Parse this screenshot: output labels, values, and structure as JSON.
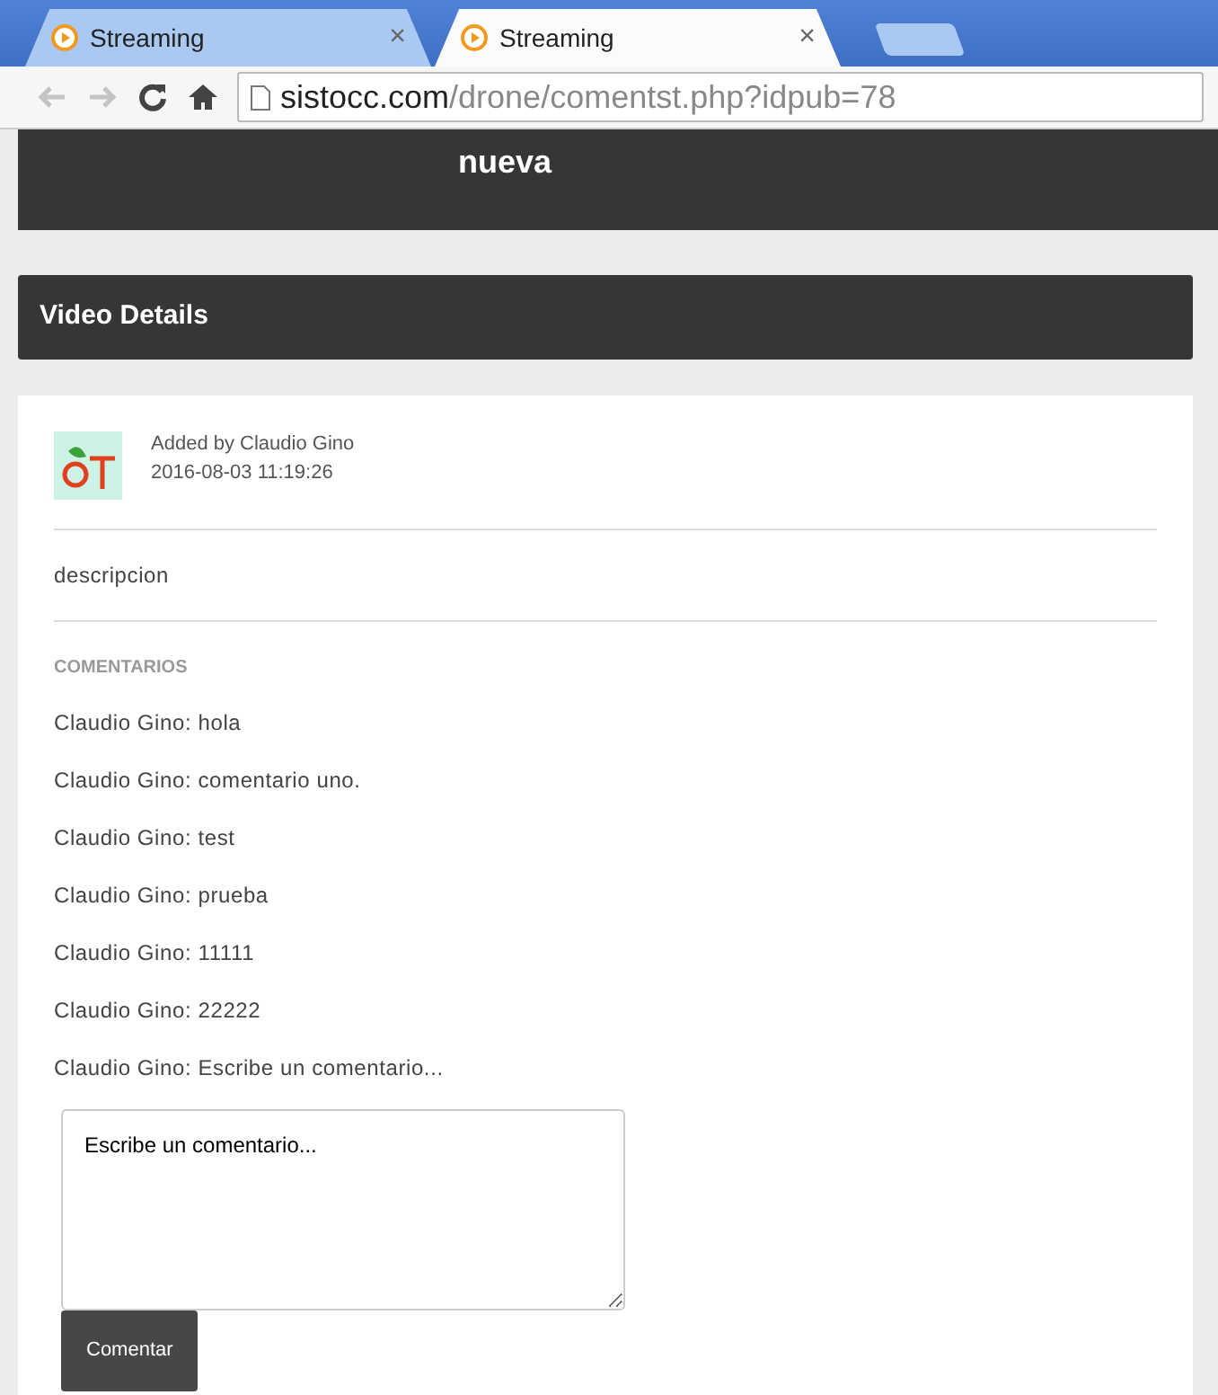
{
  "browser": {
    "tabs": [
      {
        "label": "Streaming",
        "close": "×",
        "selected": false
      },
      {
        "label": "Streaming",
        "close": "×",
        "selected": true
      }
    ],
    "address": {
      "domain": "sistocc.com",
      "path": "/drone/comentst.php?idpub=78"
    }
  },
  "header": {
    "title": "nueva"
  },
  "section": {
    "title": "Video Details"
  },
  "post": {
    "author": "Added by Claudio Gino",
    "date": "2016-08-03 11:19:26",
    "description": "descripcion"
  },
  "comments": {
    "heading": "COMENTARIOS",
    "items": [
      "Claudio Gino: hola",
      "Claudio Gino: comentario uno.",
      "Claudio Gino: test",
      "Claudio Gino: prueba",
      "Claudio Gino: 11111",
      "Claudio Gino: 22222",
      "Claudio Gino: Escribe un comentario..."
    ],
    "input": {
      "value": "Escribe un comentario..."
    },
    "submit": "Comentar"
  }
}
